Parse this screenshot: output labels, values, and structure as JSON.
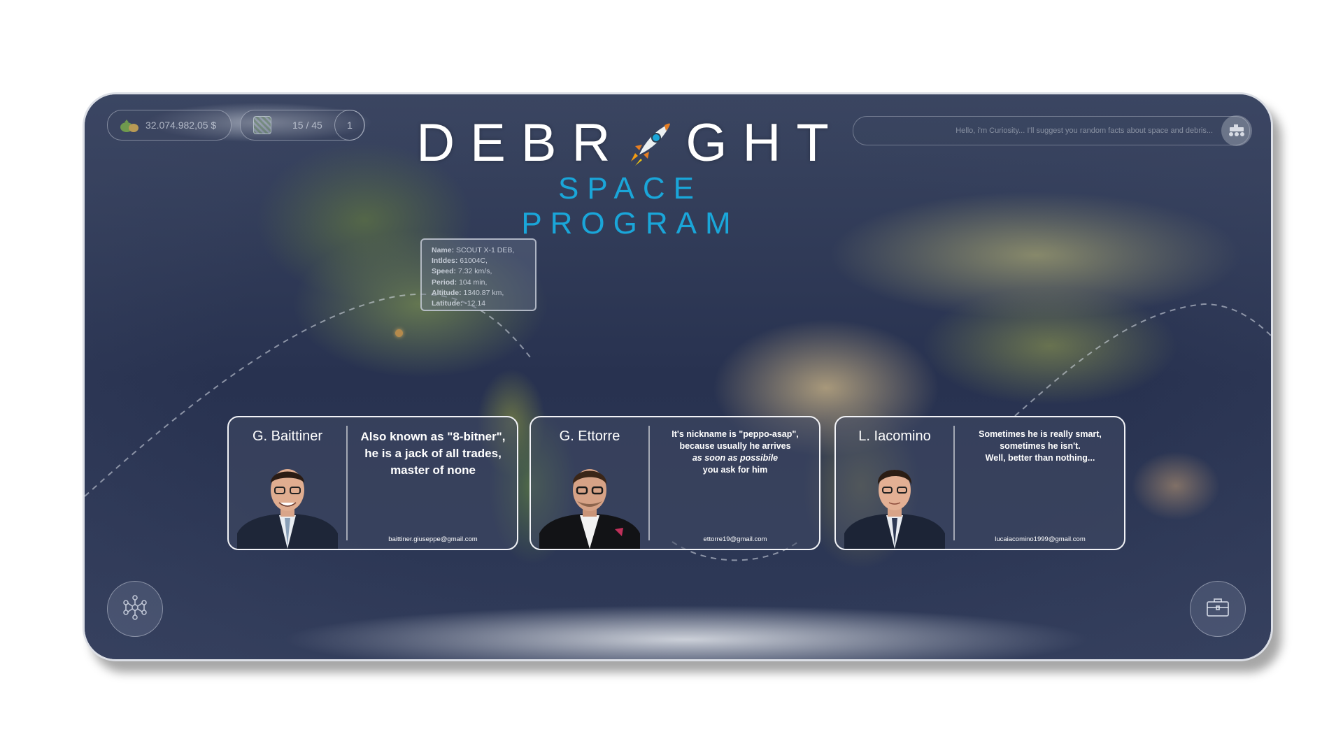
{
  "hud": {
    "money": "32.074.982,05 $",
    "satellites": "15 / 45",
    "level": "1"
  },
  "facts": {
    "text": "Hello, i'm Curiosity... I'll suggest you random facts about space and debris..."
  },
  "logo": {
    "title_left": "DEBR",
    "title_right": "GHT",
    "subtitle": "SPACE PROGRAM"
  },
  "tooltip": {
    "name_label": "Name:",
    "name_value": "SCOUT X-1 DEB,",
    "intldes_label": "Intldes:",
    "intldes_value": "61004C,",
    "speed_label": "Speed:",
    "speed_value": "7.32 km/s,",
    "period_label": "Period:",
    "period_value": "104 min,",
    "altitude_label": "Altitude:",
    "altitude_value": "1340.87 km,",
    "latitude_label": "Latitude:",
    "latitude_value": "-12.14"
  },
  "cards": [
    {
      "name": "G. Baittiner",
      "quote_lines": [
        "Also known as \"8-bitner\",",
        "he is a jack of all trades,",
        "master of none"
      ],
      "email": "baittiner.giuseppe@gmail.com"
    },
    {
      "name": "G. Ettorre",
      "quote_lines": [
        "It's nickname is \"peppo-asap\",",
        "because usually he arrives",
        "as soon as possibile",
        "you ask for him"
      ],
      "email": "ettorre19@gmail.com"
    },
    {
      "name": "L. Iacomino",
      "quote_lines": [
        "Sometimes he is really smart,",
        "sometimes he isn't.",
        "Well, better than nothing..."
      ],
      "email": "lucaiacomino1999@gmail.com"
    }
  ],
  "icons": {
    "money": "money-bag-icon",
    "satellite": "satellite-map-icon",
    "rover": "rover-icon",
    "rocket": "rocket-icon",
    "network": "network-icon",
    "briefcase": "briefcase-icon"
  },
  "colors": {
    "subtitle": "#1aa6d9",
    "card_border": "#f2f3f7"
  }
}
